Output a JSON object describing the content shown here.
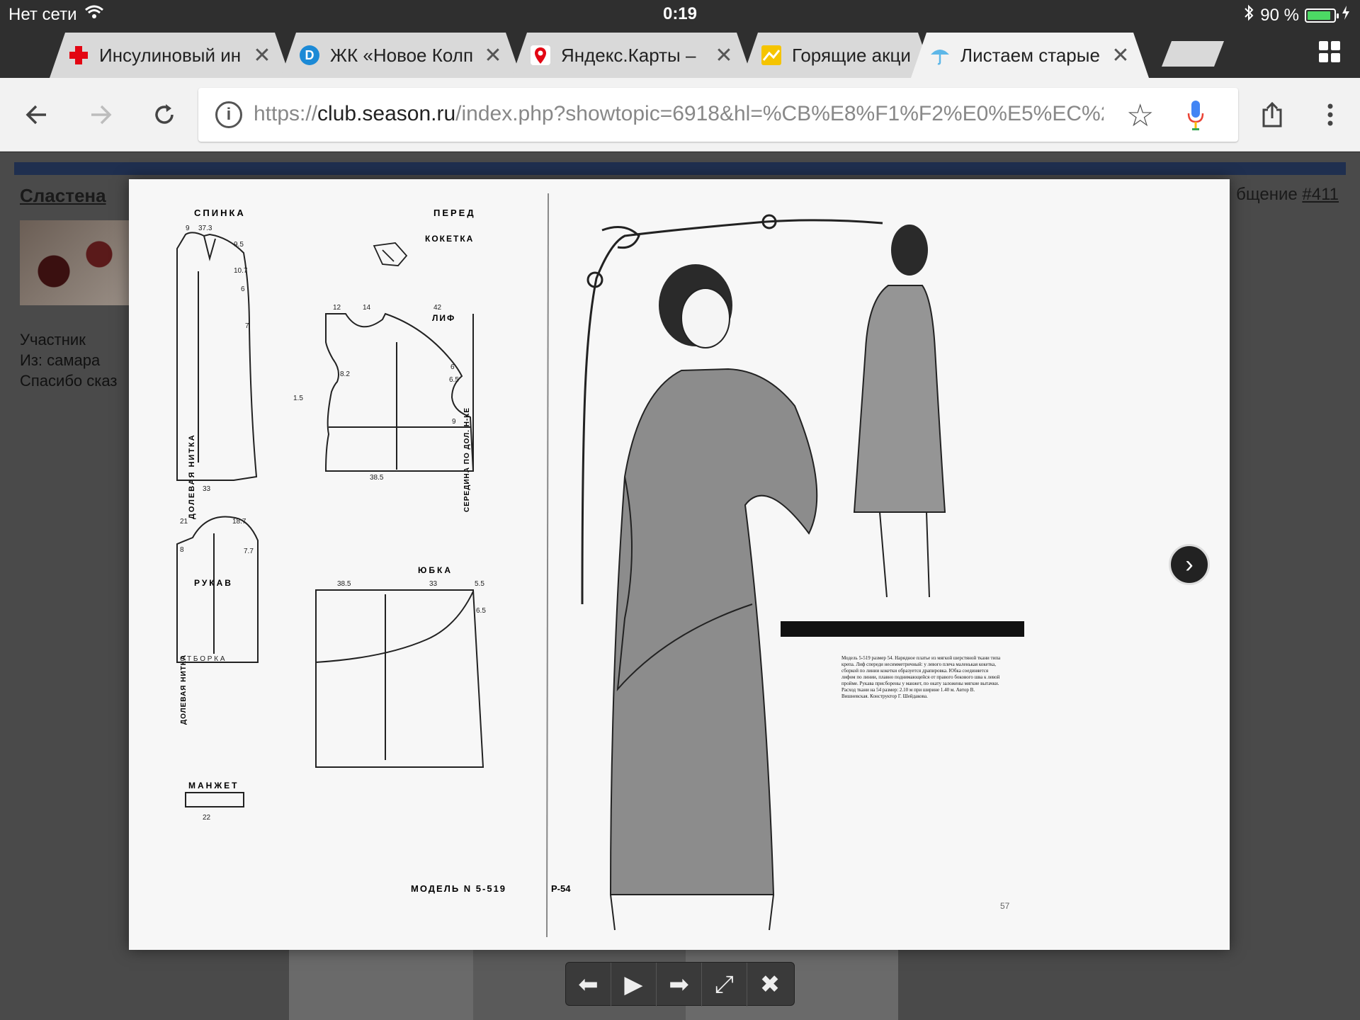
{
  "status_bar": {
    "network": "Нет сети",
    "time": "0:19",
    "battery": "90 %",
    "battery_level": 0.9
  },
  "tabs": [
    {
      "title": "Инсулиновый ин",
      "favicon": "red-cross-icon",
      "active": false
    },
    {
      "title": "ЖК «Новое Колп",
      "favicon": "d-circle-icon",
      "active": false
    },
    {
      "title": "Яндекс.Карты –",
      "favicon": "map-pin-icon",
      "active": false
    },
    {
      "title": "Горящие акци",
      "favicon": "yellow-arrow-icon",
      "active": false
    },
    {
      "title": "Листаем старые",
      "favicon": "umbrella-icon",
      "active": true
    }
  ],
  "toolbar": {
    "url_scheme": "https://",
    "url_host": "club.season.ru",
    "url_path": "/index.php?showtopic=6918&hl=%CB%E8%F1%F2%E0%E5%EC%20%"
  },
  "page": {
    "author": "Сластена",
    "post_prefix": "бщение",
    "post_number": "#411",
    "user_role": "Участник",
    "user_from": "Из: самара",
    "user_thanks": "Спасибо сказ"
  },
  "figure": {
    "labels": {
      "back": "СПИНКА",
      "front": "ПЕРЕД",
      "yoke": "КОКЕТКА",
      "bodice": "ЛИФ",
      "sleeve": "РУКАВ",
      "skirt": "ЮБКА",
      "cuff": "МАНЖЕТ",
      "grain": "ДОЛЕВАЯ НИТКА",
      "center_front": "СЕРЕДИНА ПО ДОЛ. Н-КЕ",
      "model": "МОДЕЛЬ N 5-519",
      "size": "Р-54",
      "page_number": "57"
    },
    "caption": "Модель 5-519 размер 54. Нарядное платье из мягкой шерстяной ткани типа крепа. Лиф спереди несимметричный: у левого плеча маленькая кокетка, сборкой по линии кокетки образуется драпировка. Юбка соединяется лифом по линии, плавно поднимающейся от правого бокового шва к левой пройме. Рукава присборены у манжет, по окату заложены мягкие вытачки. Расход ткани на 54 размер: 2.10 м при ширине 1.40 м. Автор В. Вишневская. Конструктор Г. Шейдакова."
  },
  "colors": {
    "chrome_dark": "#2f2f2f",
    "toolbar": "#f2f2f2",
    "forum_bar": "#1f2f4f",
    "battery": "#4cd964"
  }
}
